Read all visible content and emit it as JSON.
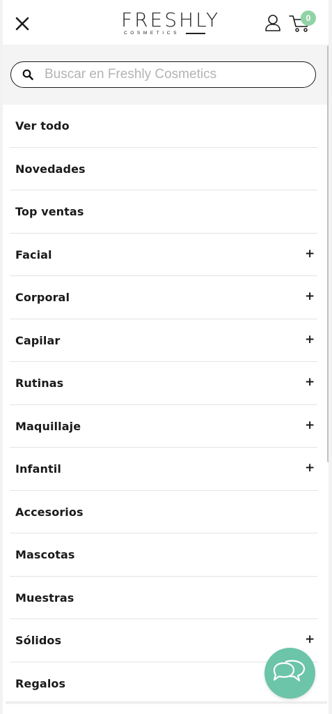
{
  "header": {
    "logo_text": "FRESHLY",
    "logo_subtext": "COSMETICS",
    "cart_count": "0"
  },
  "search": {
    "placeholder": "Buscar en Freshly Cosmetics",
    "value": ""
  },
  "menu": {
    "items": [
      {
        "label": "Ver todo",
        "expandable": false
      },
      {
        "label": "Novedades",
        "expandable": false
      },
      {
        "label": "Top ventas",
        "expandable": false
      },
      {
        "label": "Facial",
        "expandable": true
      },
      {
        "label": "Corporal",
        "expandable": true
      },
      {
        "label": "Capilar",
        "expandable": true
      },
      {
        "label": "Rutinas",
        "expandable": true
      },
      {
        "label": "Maquillaje",
        "expandable": true
      },
      {
        "label": "Infantil",
        "expandable": true
      },
      {
        "label": "Accesorios",
        "expandable": false
      },
      {
        "label": "Mascotas",
        "expandable": false
      },
      {
        "label": "Muestras",
        "expandable": false
      },
      {
        "label": "Sólidos",
        "expandable": true
      },
      {
        "label": "Regalos",
        "expandable": false
      }
    ],
    "expand_symbol": "+"
  },
  "icons": {
    "close": "close-icon",
    "user": "user-icon",
    "cart": "cart-icon",
    "search": "search-icon",
    "chat": "chat-bubbles-icon",
    "expand": "plus-icon"
  },
  "colors": {
    "accent": "#6cc4a9",
    "badge": "#8fd3a6",
    "text": "#1a1a1a",
    "placeholder": "#b3b3b3"
  }
}
